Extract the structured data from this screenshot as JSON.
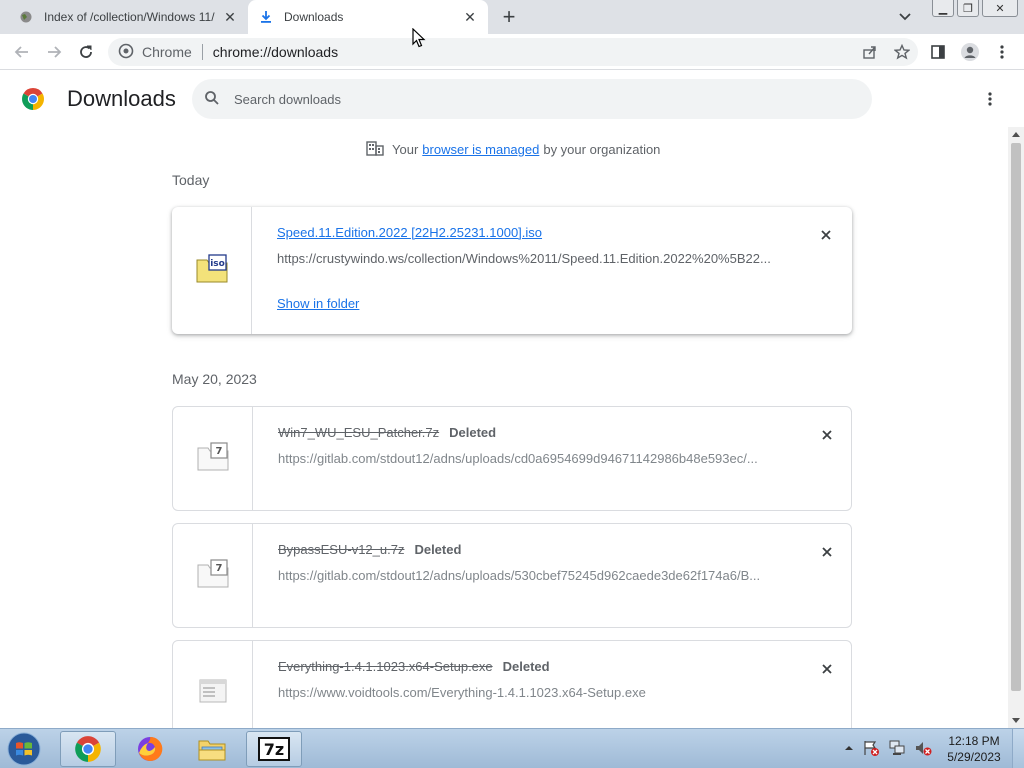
{
  "tabs": [
    {
      "title": "Index of /collection/Windows 11/",
      "active": false
    },
    {
      "title": "Downloads",
      "active": true
    }
  ],
  "omnibox": {
    "chip": "Chrome",
    "url": "chrome://downloads"
  },
  "page": {
    "title": "Downloads",
    "search_placeholder": "Search downloads",
    "managed": {
      "prefix": "Your",
      "link": "browser is managed",
      "suffix": "by your organization"
    }
  },
  "groups": [
    {
      "date": "Today",
      "items": [
        {
          "filename": "Speed.11.Edition.2022 [22H2.25231.1000].iso",
          "url": "https://crustywindo.ws/collection/Windows%2011/Speed.11.Edition.2022%20%5B22...",
          "action": "Show in folder",
          "status": ""
        }
      ]
    },
    {
      "date": "May 20, 2023",
      "items": [
        {
          "filename": "Win7_WU_ESU_Patcher.7z",
          "status": "Deleted",
          "url": "https://gitlab.com/stdout12/adns/uploads/cd0a6954699d94671142986b48e593ec/..."
        },
        {
          "filename": "BypassESU-v12_u.7z",
          "status": "Deleted",
          "url": "https://gitlab.com/stdout12/adns/uploads/530cbef75245d962caede3de62f174a6/B..."
        },
        {
          "filename": "Everything-1.4.1.1023.x64-Setup.exe",
          "status": "Deleted",
          "url": "https://www.voidtools.com/Everything-1.4.1.1023.x64-Setup.exe"
        }
      ]
    }
  ],
  "taskbar": {
    "items": [
      "start-orb-icon",
      "chrome-icon",
      "firefox-icon",
      "explorer-icon",
      "7zip-icon"
    ],
    "time": "12:18 PM",
    "date": "5/29/2023"
  },
  "colors": {
    "link": "#1a73e8",
    "tabstrip": "#dee1e6",
    "omnibox": "#f1f3f4"
  }
}
